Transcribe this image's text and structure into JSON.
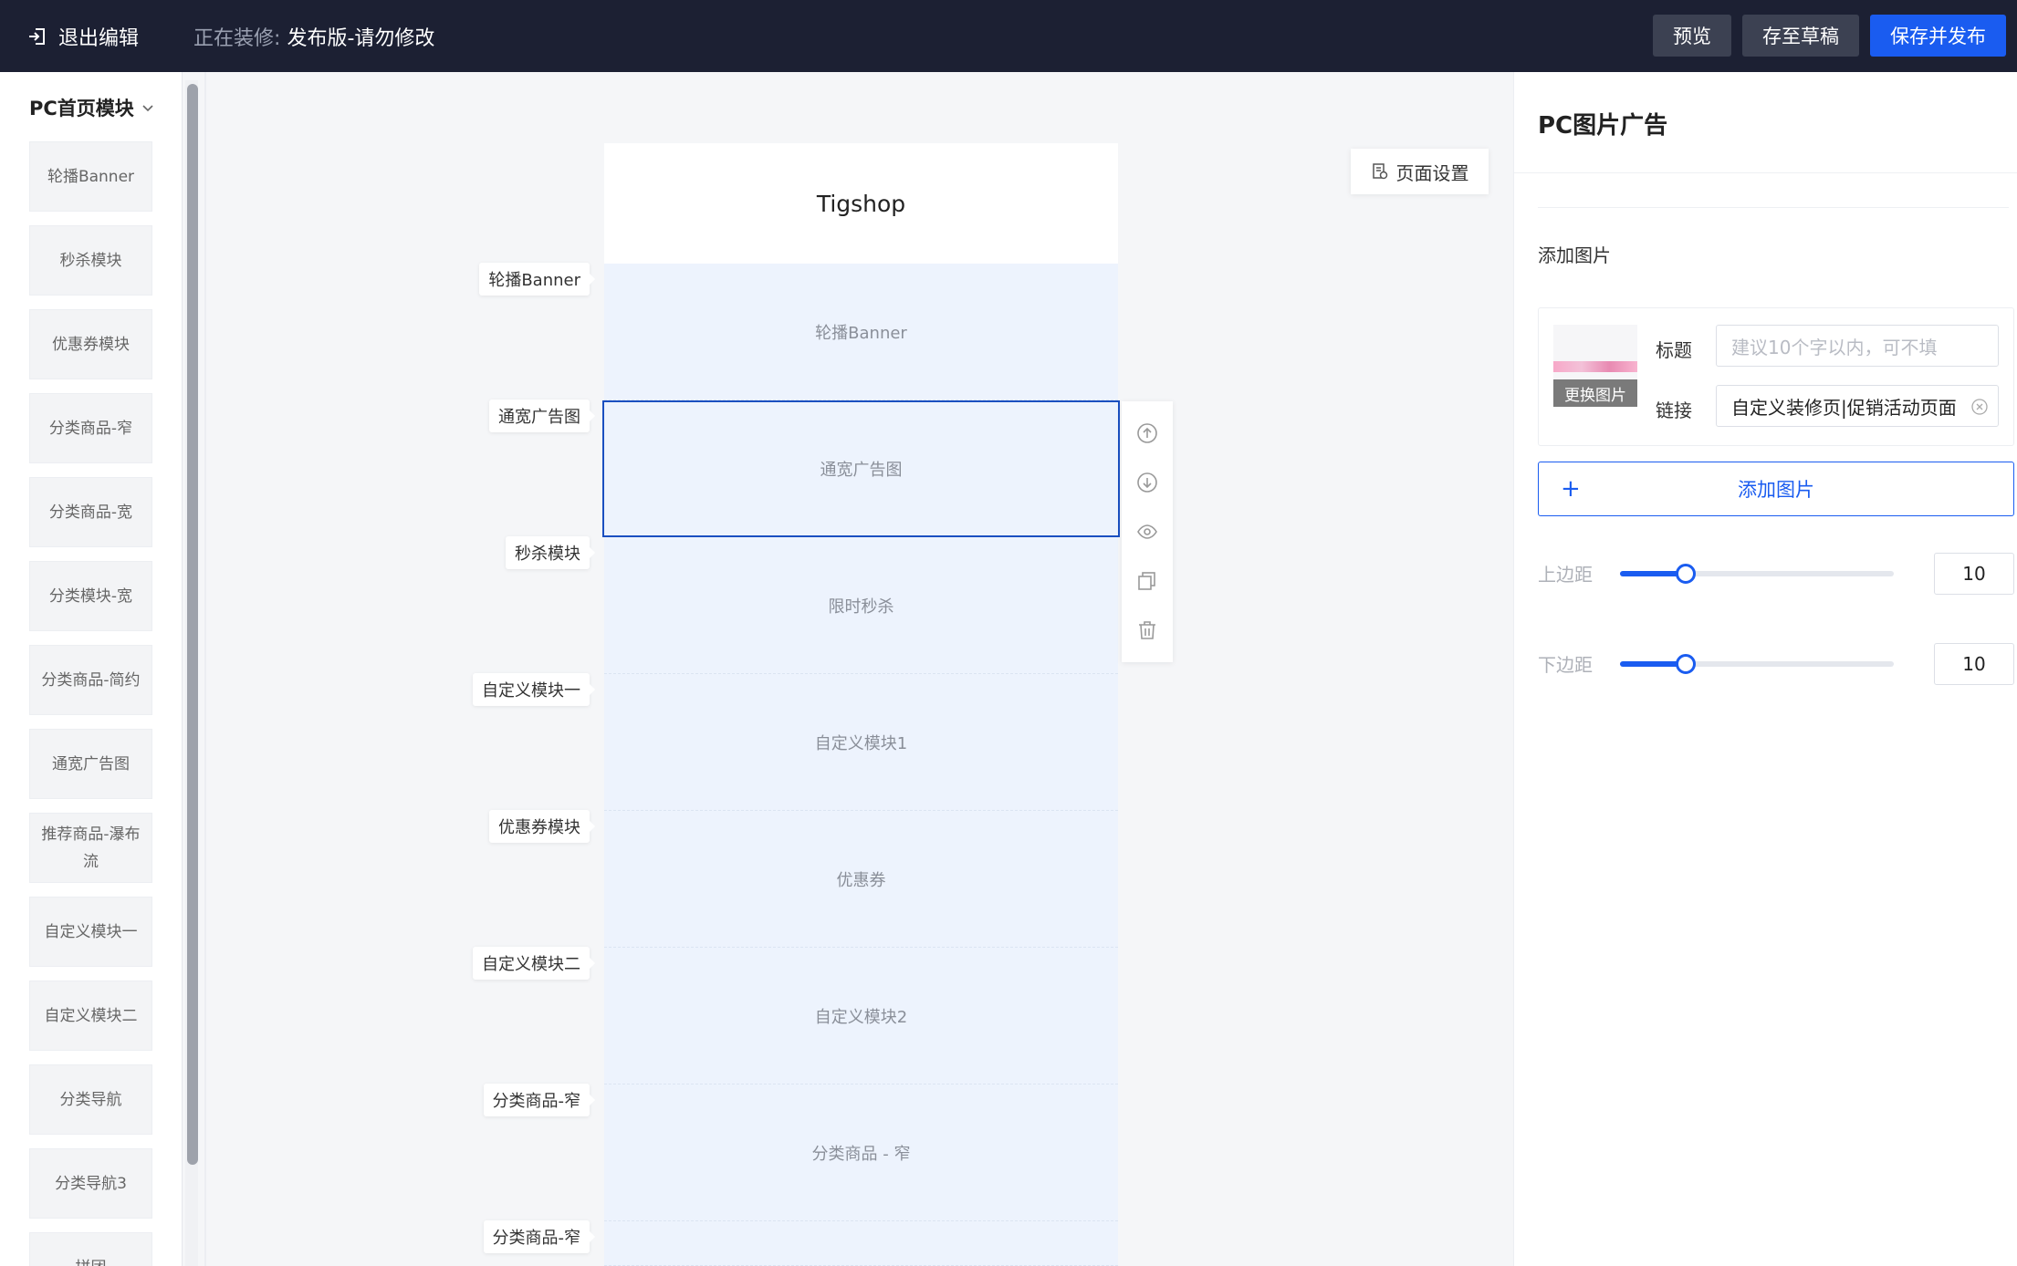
{
  "topbar": {
    "exit_label": "退出编辑",
    "editing_prefix": "正在装修:",
    "editing_name": "发布版-请勿修改",
    "preview_label": "预览",
    "draft_label": "存至草稿",
    "publish_label": "保存并发布"
  },
  "sidebar": {
    "title": "PC首页模块",
    "items": [
      {
        "label": "轮播Banner"
      },
      {
        "label": "秒杀模块"
      },
      {
        "label": "优惠券模块"
      },
      {
        "label": "分类商品-窄"
      },
      {
        "label": "分类商品-宽"
      },
      {
        "label": "分类模块-宽"
      },
      {
        "label": "分类商品-简约"
      },
      {
        "label": "通宽广告图"
      },
      {
        "label": "推荐商品-瀑布流"
      },
      {
        "label": "自定义模块一"
      },
      {
        "label": "自定义模块二"
      },
      {
        "label": "分类导航"
      },
      {
        "label": "分类导航3"
      },
      {
        "label": "拼团"
      }
    ]
  },
  "canvas": {
    "header_title": "Tigshop",
    "page_settings_label": "页面设置",
    "blocks": [
      {
        "label": "轮播Banner",
        "side_label": "轮播Banner"
      },
      {
        "label": "通宽广告图",
        "side_label": "通宽广告图"
      },
      {
        "label": "限时秒杀",
        "side_label": "秒杀模块"
      },
      {
        "label": "自定义模块1",
        "side_label": "自定义模块一"
      },
      {
        "label": "优惠券",
        "side_label": "优惠券模块"
      },
      {
        "label": "自定义模块2",
        "side_label": "自定义模块二"
      },
      {
        "label": "分类商品 - 窄",
        "side_label": "分类商品-窄"
      },
      {
        "label": "",
        "side_label": "分类商品-窄"
      }
    ]
  },
  "panel": {
    "title": "PC图片广告",
    "add_image_section": "添加图片",
    "change_image_label": "更换图片",
    "title_field_label": "标题",
    "title_placeholder": "建议10个字以内，可不填",
    "link_field_label": "链接",
    "link_value": "自定义装修页|促销活动页面",
    "add_image_button": "添加图片",
    "top_margin_label": "上边距",
    "top_margin_value": "10",
    "top_margin_fraction": 0.24,
    "bottom_margin_label": "下边距",
    "bottom_margin_value": "10",
    "bottom_margin_fraction": 0.24
  },
  "colors": {
    "topbar_bg": "#1c2033",
    "primary": "#1a5cf0",
    "block_bg": "#edf3fd"
  }
}
